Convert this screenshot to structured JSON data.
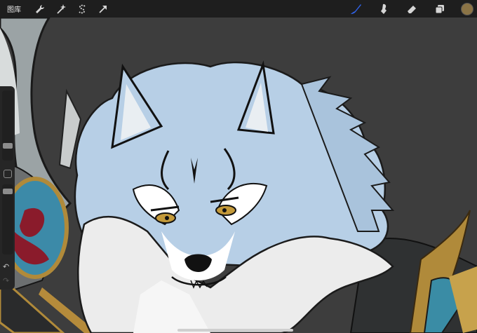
{
  "app": {
    "gallery_label": "图库",
    "current_color": "#8b7446",
    "active_tool_color": "#2f62e6"
  },
  "toolbar": {
    "left_tools": [
      "wrench-icon",
      "magic-wand-icon",
      "selection-s-icon",
      "transform-arrow-icon"
    ],
    "right_tools": [
      "brush-icon",
      "smudge-icon",
      "eraser-icon",
      "layers-icon"
    ]
  },
  "sidebar": {
    "size_level": 0.2,
    "opacity_level": 0.06,
    "undo_icon": "undo-arrow-icon",
    "redo_icon": "redo-arrow-icon"
  },
  "artwork": {
    "subject": "wolf-illustration",
    "background_color": "#3d3d3d",
    "fur_color": "#b7cfe6",
    "white_fur_color": "#ececec"
  }
}
